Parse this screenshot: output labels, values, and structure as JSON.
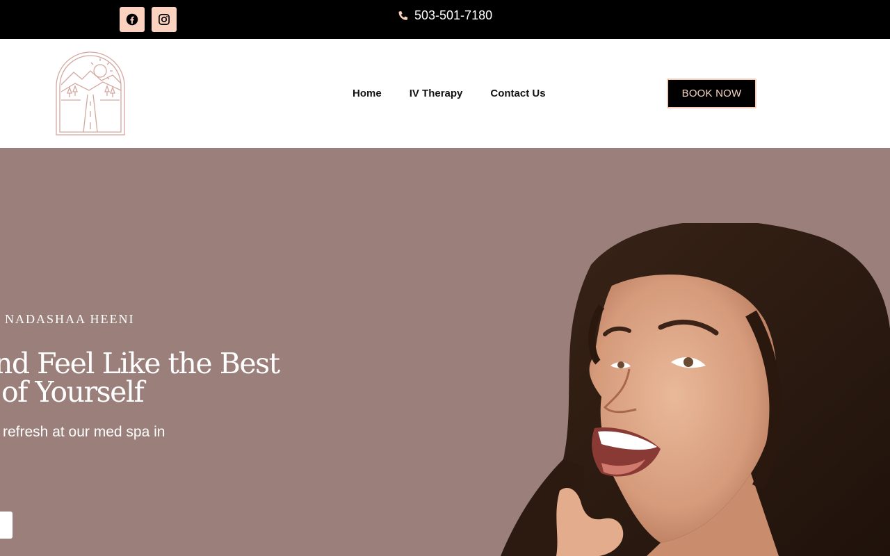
{
  "topbar": {
    "social": [
      {
        "icon": "facebook-icon",
        "bg": "#fbd2c0"
      },
      {
        "icon": "instagram-icon",
        "bg": "#fbd2c0"
      }
    ],
    "phone_icon": "phone-icon",
    "phone": "503-501-7180"
  },
  "header": {
    "logo_icon": "arch-landscape-logo",
    "nav": [
      "Home",
      "IV Therapy",
      "Contact Us"
    ],
    "book_label": "BOOK NOW",
    "accent": "#f3cdb8"
  },
  "hero": {
    "bg": "#9b7f7b",
    "eyebrow": "NADASHAA HEENI",
    "headline_line1": "nd Feel Like the Best",
    "headline_line2": "of Yourself",
    "subtext": "refresh at our med spa in"
  }
}
